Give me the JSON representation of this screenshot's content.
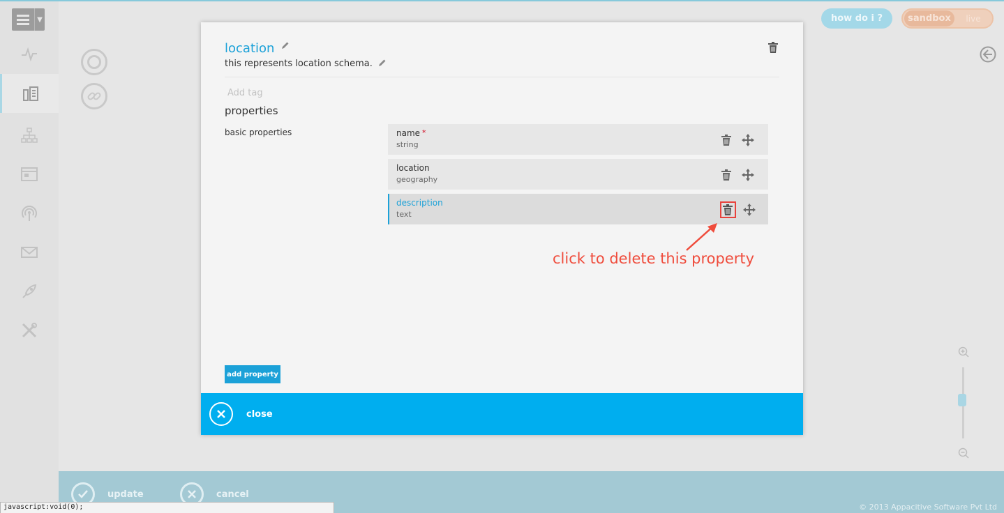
{
  "header": {
    "help_label": "how do i ?",
    "env_toggle": {
      "active": "sandbox",
      "inactive": "live"
    }
  },
  "sidebar": {
    "items": [
      {
        "icon": "activity-icon"
      },
      {
        "icon": "schema-icon",
        "active": true
      },
      {
        "icon": "hierarchy-icon"
      },
      {
        "icon": "window-icon"
      },
      {
        "icon": "broadcast-icon"
      },
      {
        "icon": "mail-icon"
      },
      {
        "icon": "rocket-icon"
      },
      {
        "icon": "tools-icon"
      }
    ]
  },
  "modal": {
    "title": "location",
    "description": "this represents location schema.",
    "tag_placeholder": "Add tag",
    "properties_heading": "properties",
    "group_label": "basic properties",
    "properties": [
      {
        "name": "name",
        "type": "string",
        "required": "*"
      },
      {
        "name": "location",
        "type": "geography"
      },
      {
        "name": "description",
        "type": "text"
      }
    ],
    "annotation": "click to delete this property",
    "add_property_label": "add property",
    "close_label": "close"
  },
  "footer": {
    "update_label": "update",
    "cancel_label": "cancel",
    "copyright": "© 2013 Appacitive Software Pvt Ltd"
  },
  "statusbar": {
    "text": "javascript:void(0);"
  },
  "colors": {
    "accent": "#1ba1d8",
    "modal_footer": "#00aeef",
    "annotation": "#ef4c3c",
    "required": "#d0021b"
  }
}
